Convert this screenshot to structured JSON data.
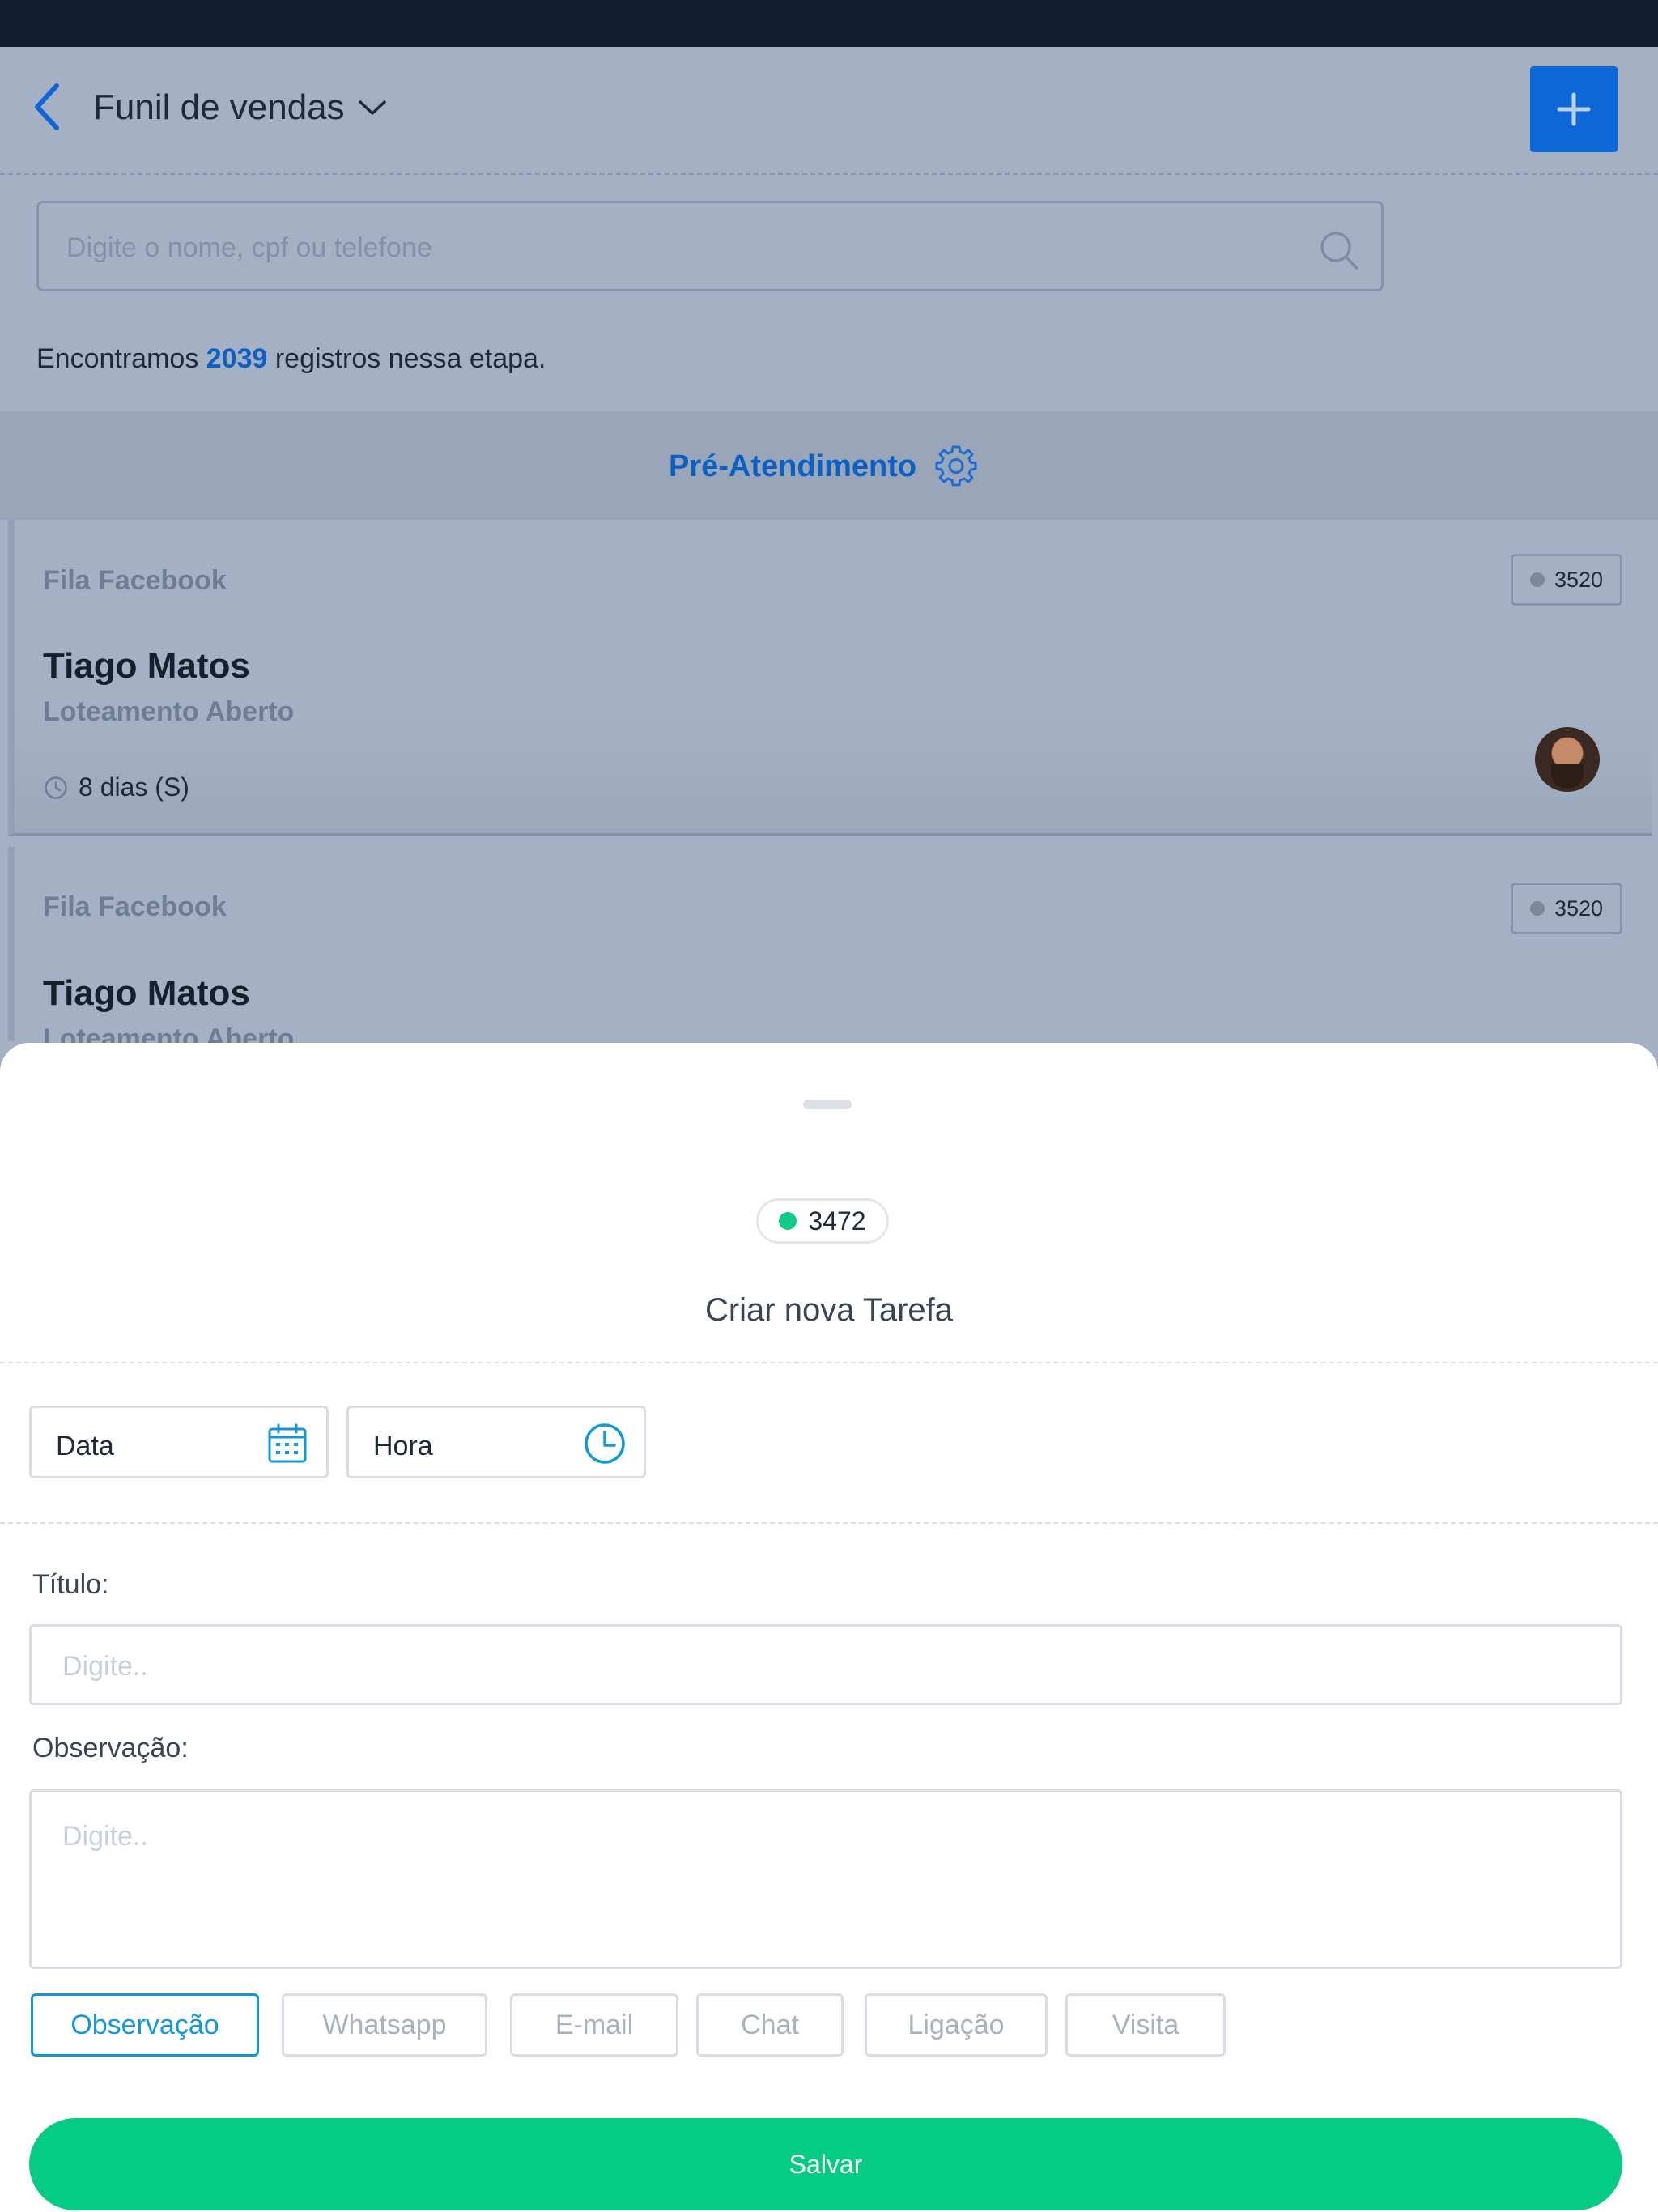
{
  "header": {
    "title": "Funil de vendas"
  },
  "search": {
    "placeholder": "Digite o nome, cpf ou telefone"
  },
  "results": {
    "prefix": "Encontramos ",
    "count": "2039",
    "suffix": " registros nessa etapa."
  },
  "stage": {
    "title": "Pré-Atendimento"
  },
  "cards": [
    {
      "queue": "Fila Facebook",
      "badge": "3520",
      "name": "Tiago Matos",
      "subtitle": "Loteamento Aberto",
      "time": "8 dias (S)"
    },
    {
      "queue": "Fila Facebook",
      "badge": "3520",
      "name": "Tiago Matos",
      "subtitle": "Loteamento Aberto"
    }
  ],
  "sheet": {
    "id_badge": "3472",
    "title": "Criar nova Tarefa",
    "date_label": "Data",
    "time_label": "Hora",
    "title_field_label": "Título:",
    "title_field_placeholder": "Digite..",
    "obs_field_label": "Observação:",
    "obs_field_placeholder": "Digite..",
    "types": [
      "Observação",
      "Whatsapp",
      "E-mail",
      "Chat",
      "Ligação",
      "Visita"
    ],
    "selected_type": "Observação",
    "save_label": "Salvar"
  },
  "colors": {
    "primary": "#0d67d9",
    "accent": "#1497d8",
    "success": "#06cb85",
    "status_dot": "#0fcb87"
  }
}
